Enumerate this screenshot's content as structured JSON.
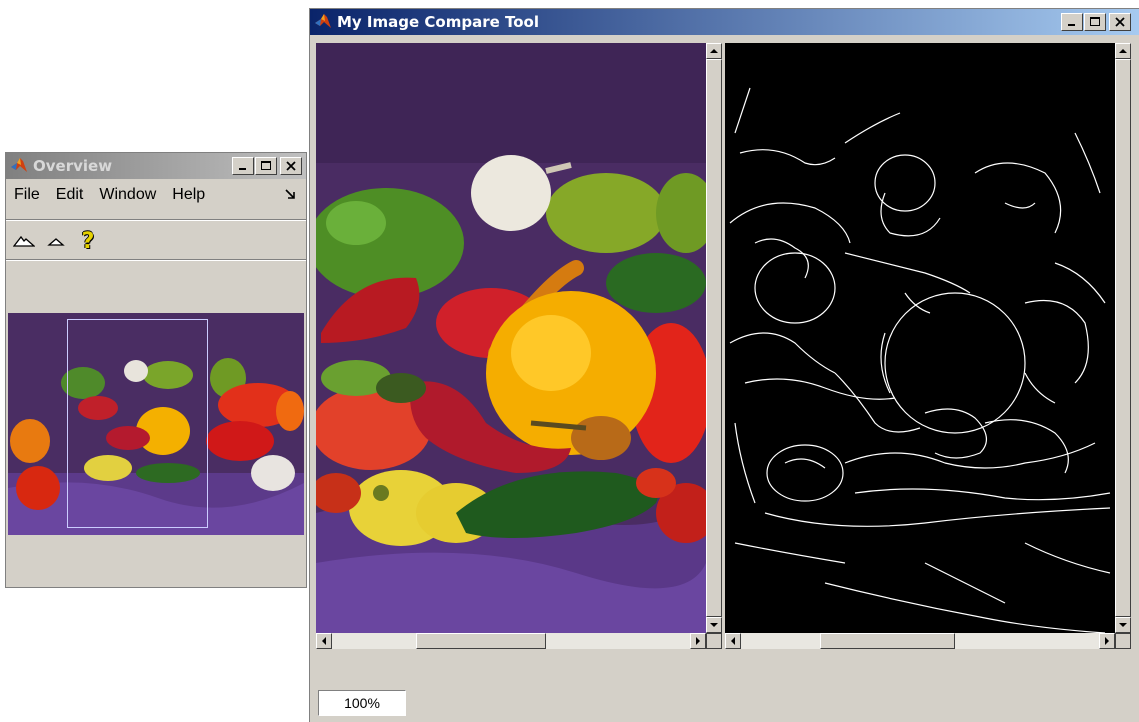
{
  "overview_window": {
    "title": "Overview",
    "menu": [
      "File",
      "Edit",
      "Window",
      "Help"
    ],
    "tools": [
      "zoom-in-icon",
      "zoom-out-icon",
      "help-icon"
    ]
  },
  "compare_window": {
    "title": "My Image Compare Tool",
    "left_image": "peppers-color-image",
    "right_image": "peppers-edge-detection-image",
    "magnification": "100%"
  },
  "colors": {
    "title_active": "#0a246a",
    "title_inactive": "#808080",
    "window_face": "#d4d0c8",
    "detail_rect": "#ccccff"
  }
}
